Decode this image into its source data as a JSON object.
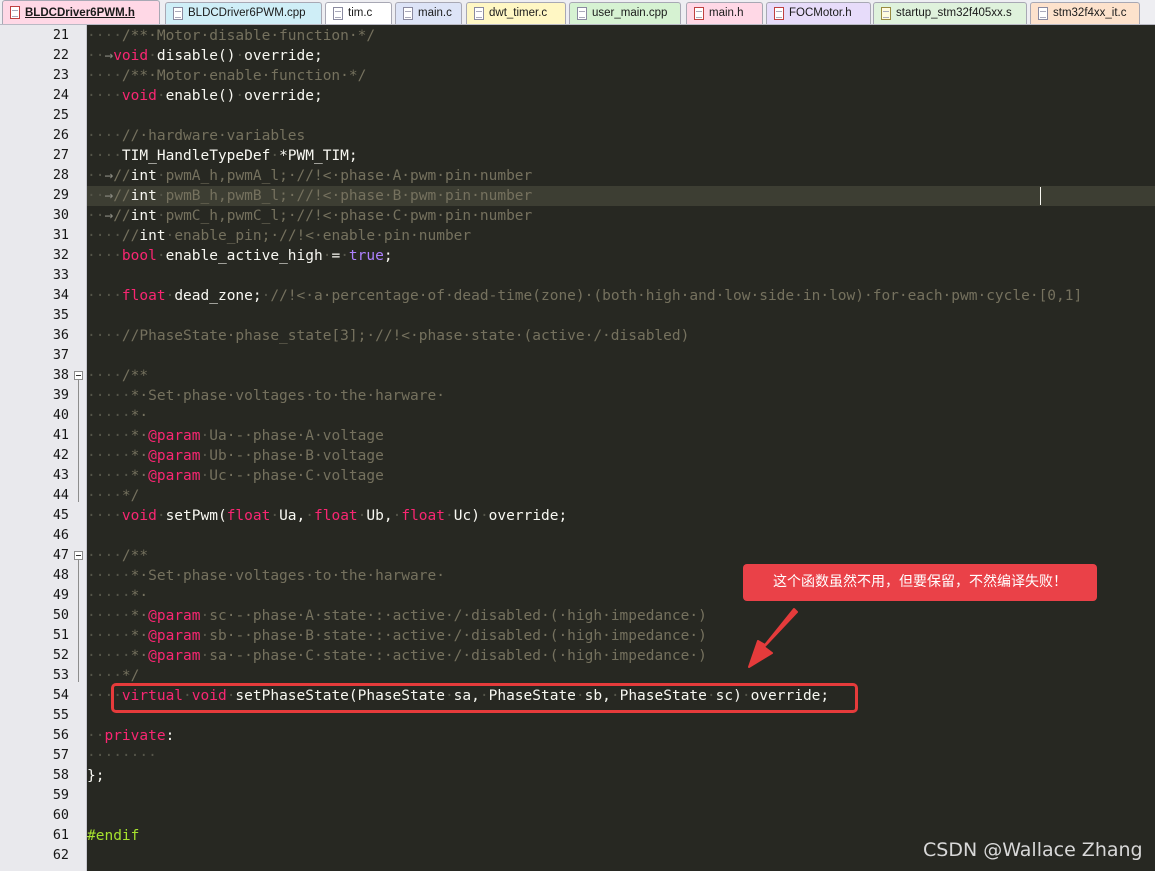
{
  "tabs": [
    {
      "label": "BLDCDriver6PWM.h",
      "active": true,
      "icon": "header-file-icon"
    },
    {
      "label": "BLDCDriver6PWM.cpp",
      "active": false,
      "icon": "source-file-icon"
    },
    {
      "label": "tim.c",
      "active": false,
      "icon": "source-file-icon"
    },
    {
      "label": "main.c",
      "active": false,
      "icon": "source-file-icon"
    },
    {
      "label": "dwt_timer.c",
      "active": false,
      "icon": "source-file-icon"
    },
    {
      "label": "user_main.cpp",
      "active": false,
      "icon": "source-file-icon"
    },
    {
      "label": "main.h",
      "active": false,
      "icon": "header-file-icon"
    },
    {
      "label": "FOCMotor.h",
      "active": false,
      "icon": "header-file-icon"
    },
    {
      "label": "startup_stm32f405xx.s",
      "active": false,
      "icon": "asm-file-icon"
    },
    {
      "label": "stm32f4xx_it.c",
      "active": false,
      "icon": "source-file-icon"
    }
  ],
  "editor": {
    "current_line": 29,
    "fold_lines": [
      38,
      47
    ],
    "lines": [
      {
        "n": 21,
        "tokens": [
          [
            "ws",
            "····"
          ],
          [
            "cm",
            "/**·Motor·disable·function·*/"
          ]
        ]
      },
      {
        "n": 22,
        "tokens": [
          [
            "ws",
            "··"
          ],
          [
            "arr",
            "→"
          ],
          [
            "kw",
            "void"
          ],
          [
            "ws",
            "·"
          ],
          [
            "id",
            "disable()"
          ],
          [
            "ws",
            "·"
          ],
          [
            "id",
            "override;"
          ]
        ]
      },
      {
        "n": 23,
        "tokens": [
          [
            "ws",
            "····"
          ],
          [
            "cm",
            "/**·Motor·enable·function·*/"
          ]
        ]
      },
      {
        "n": 24,
        "tokens": [
          [
            "ws",
            "····"
          ],
          [
            "kw",
            "void"
          ],
          [
            "ws",
            "·"
          ],
          [
            "id",
            "enable()"
          ],
          [
            "ws",
            "·"
          ],
          [
            "id",
            "override;"
          ]
        ]
      },
      {
        "n": 25,
        "tokens": []
      },
      {
        "n": 26,
        "tokens": [
          [
            "ws",
            "····"
          ],
          [
            "cm",
            "//·hardware·variables"
          ]
        ]
      },
      {
        "n": 27,
        "tokens": [
          [
            "ws",
            "····"
          ],
          [
            "id",
            "TIM_HandleTypeDef"
          ],
          [
            "ws",
            "·"
          ],
          [
            "id",
            "*PWM_TIM;"
          ]
        ]
      },
      {
        "n": 28,
        "tokens": [
          [
            "ws",
            "··"
          ],
          [
            "arr",
            "→"
          ],
          [
            "cm",
            "//"
          ],
          [
            "id",
            "int"
          ],
          [
            "ws",
            "·"
          ],
          [
            "cm",
            "pwmA_h,pwmA_l;·//!<·phase·A·pwm·pin·number"
          ]
        ]
      },
      {
        "n": 29,
        "tokens": [
          [
            "ws",
            "··"
          ],
          [
            "arr",
            "→"
          ],
          [
            "cm",
            "//"
          ],
          [
            "id",
            "int"
          ],
          [
            "ws",
            "·"
          ],
          [
            "cm",
            "pwmB_h,pwmB_l;·//!<·phase·B·pwm·pin·number"
          ]
        ]
      },
      {
        "n": 30,
        "tokens": [
          [
            "ws",
            "··"
          ],
          [
            "arr",
            "→"
          ],
          [
            "cm",
            "//"
          ],
          [
            "id",
            "int"
          ],
          [
            "ws",
            "·"
          ],
          [
            "cm",
            "pwmC_h,pwmC_l;·//!<·phase·C·pwm·pin·number"
          ]
        ]
      },
      {
        "n": 31,
        "tokens": [
          [
            "ws",
            "····"
          ],
          [
            "cm",
            "//"
          ],
          [
            "id",
            "int"
          ],
          [
            "ws",
            "·"
          ],
          [
            "cm",
            "enable_pin;·//!<·enable·pin·number"
          ]
        ]
      },
      {
        "n": 32,
        "tokens": [
          [
            "ws",
            "····"
          ],
          [
            "kw",
            "bool"
          ],
          [
            "ws",
            "·"
          ],
          [
            "id",
            "enable_active_high"
          ],
          [
            "ws",
            "·"
          ],
          [
            "id",
            "="
          ],
          [
            "ws",
            "·"
          ],
          [
            "val",
            "true"
          ],
          [
            "id",
            ";"
          ]
        ]
      },
      {
        "n": 33,
        "tokens": []
      },
      {
        "n": 34,
        "tokens": [
          [
            "ws",
            "····"
          ],
          [
            "kw",
            "float"
          ],
          [
            "ws",
            "·"
          ],
          [
            "id",
            "dead_zone;"
          ],
          [
            "ws",
            "·"
          ],
          [
            "cm",
            "//!<·a·percentage·of·dead-time(zone)·(both·high·and·low·side·in·low)·for·each·pwm·cycle·[0,1]"
          ]
        ]
      },
      {
        "n": 35,
        "tokens": []
      },
      {
        "n": 36,
        "tokens": [
          [
            "ws",
            "····"
          ],
          [
            "cm",
            "//PhaseState·phase_state[3];·//!<·phase·state·(active·/·disabled)"
          ]
        ]
      },
      {
        "n": 37,
        "tokens": []
      },
      {
        "n": 38,
        "tokens": [
          [
            "ws",
            "····"
          ],
          [
            "cm",
            "/**"
          ]
        ]
      },
      {
        "n": 39,
        "tokens": [
          [
            "ws",
            "·····"
          ],
          [
            "cm",
            "*·Set·phase·voltages·to·the·harware·"
          ]
        ]
      },
      {
        "n": 40,
        "tokens": [
          [
            "ws",
            "·····"
          ],
          [
            "cm",
            "*·"
          ]
        ]
      },
      {
        "n": 41,
        "tokens": [
          [
            "ws",
            "·····"
          ],
          [
            "cm",
            "*·"
          ],
          [
            "kw",
            "@param"
          ],
          [
            "ws",
            "·"
          ],
          [
            "cm",
            "Ua·-·phase·A·voltage"
          ]
        ]
      },
      {
        "n": 42,
        "tokens": [
          [
            "ws",
            "·····"
          ],
          [
            "cm",
            "*·"
          ],
          [
            "kw",
            "@param"
          ],
          [
            "ws",
            "·"
          ],
          [
            "cm",
            "Ub·-·phase·B·voltage"
          ]
        ]
      },
      {
        "n": 43,
        "tokens": [
          [
            "ws",
            "·····"
          ],
          [
            "cm",
            "*·"
          ],
          [
            "kw",
            "@param"
          ],
          [
            "ws",
            "·"
          ],
          [
            "cm",
            "Uc·-·phase·C·voltage"
          ]
        ]
      },
      {
        "n": 44,
        "tokens": [
          [
            "ws",
            "····"
          ],
          [
            "cm",
            "*/"
          ]
        ]
      },
      {
        "n": 45,
        "tokens": [
          [
            "ws",
            "····"
          ],
          [
            "kw",
            "void"
          ],
          [
            "ws",
            "·"
          ],
          [
            "id",
            "setPwm("
          ],
          [
            "kw",
            "float"
          ],
          [
            "ws",
            "·"
          ],
          [
            "id",
            "Ua,"
          ],
          [
            "ws",
            "·"
          ],
          [
            "kw",
            "float"
          ],
          [
            "ws",
            "·"
          ],
          [
            "id",
            "Ub,"
          ],
          [
            "ws",
            "·"
          ],
          [
            "kw",
            "float"
          ],
          [
            "ws",
            "·"
          ],
          [
            "id",
            "Uc)"
          ],
          [
            "ws",
            "·"
          ],
          [
            "id",
            "override;"
          ]
        ]
      },
      {
        "n": 46,
        "tokens": []
      },
      {
        "n": 47,
        "tokens": [
          [
            "ws",
            "····"
          ],
          [
            "cm",
            "/**"
          ]
        ]
      },
      {
        "n": 48,
        "tokens": [
          [
            "ws",
            "·····"
          ],
          [
            "cm",
            "*·Set·phase·voltages·to·the·harware·"
          ]
        ]
      },
      {
        "n": 49,
        "tokens": [
          [
            "ws",
            "·····"
          ],
          [
            "cm",
            "*·"
          ]
        ]
      },
      {
        "n": 50,
        "tokens": [
          [
            "ws",
            "·····"
          ],
          [
            "cm",
            "*·"
          ],
          [
            "kw",
            "@param"
          ],
          [
            "ws",
            "·"
          ],
          [
            "cm",
            "sc·-·phase·A·state·:·active·/·disabled·(·high·impedance·)"
          ]
        ]
      },
      {
        "n": 51,
        "tokens": [
          [
            "ws",
            "·····"
          ],
          [
            "cm",
            "*·"
          ],
          [
            "kw",
            "@param"
          ],
          [
            "ws",
            "·"
          ],
          [
            "cm",
            "sb·-·phase·B·state·:·active·/·disabled·(·high·impedance·)"
          ]
        ]
      },
      {
        "n": 52,
        "tokens": [
          [
            "ws",
            "·····"
          ],
          [
            "cm",
            "*·"
          ],
          [
            "kw",
            "@param"
          ],
          [
            "ws",
            "·"
          ],
          [
            "cm",
            "sa·-·phase·C·state·:·active·/·disabled·(·high·impedance·)"
          ]
        ]
      },
      {
        "n": 53,
        "tokens": [
          [
            "ws",
            "····"
          ],
          [
            "cm",
            "*/"
          ]
        ]
      },
      {
        "n": 54,
        "tokens": [
          [
            "ws",
            "····"
          ],
          [
            "kw",
            "virtual"
          ],
          [
            "ws",
            "·"
          ],
          [
            "kw",
            "void"
          ],
          [
            "ws",
            "·"
          ],
          [
            "id",
            "setPhaseState(PhaseState"
          ],
          [
            "ws",
            "·"
          ],
          [
            "id",
            "sa,"
          ],
          [
            "ws",
            "·"
          ],
          [
            "id",
            "PhaseState"
          ],
          [
            "ws",
            "·"
          ],
          [
            "id",
            "sb,"
          ],
          [
            "ws",
            "·"
          ],
          [
            "id",
            "PhaseState"
          ],
          [
            "ws",
            "·"
          ],
          [
            "id",
            "sc)"
          ],
          [
            "ws",
            "·"
          ],
          [
            "id",
            "override;"
          ]
        ]
      },
      {
        "n": 55,
        "tokens": []
      },
      {
        "n": 56,
        "tokens": [
          [
            "ws",
            "··"
          ],
          [
            "kw",
            "private"
          ],
          [
            "id",
            ":"
          ]
        ]
      },
      {
        "n": 57,
        "tokens": [
          [
            "ws",
            "········"
          ]
        ]
      },
      {
        "n": 58,
        "tokens": [
          [
            "id",
            "};"
          ]
        ]
      },
      {
        "n": 59,
        "tokens": []
      },
      {
        "n": 60,
        "tokens": []
      },
      {
        "n": 61,
        "tokens": [
          [
            "pre",
            "#endif"
          ]
        ]
      },
      {
        "n": 62,
        "tokens": []
      }
    ]
  },
  "annotation": {
    "text": "这个函数虽然不用，但要保留，不然编译失败！",
    "color": "#ea4148"
  },
  "watermark": "CSDN @Wallace Zhang",
  "colors": {
    "editor_bg": "#272822",
    "keyword": "#f92672",
    "comment": "#75715e",
    "text": "#f8f8f2",
    "boolean": "#ae81ff",
    "preprocessor": "#a6e22e",
    "highlight_border": "#e53b3b"
  }
}
